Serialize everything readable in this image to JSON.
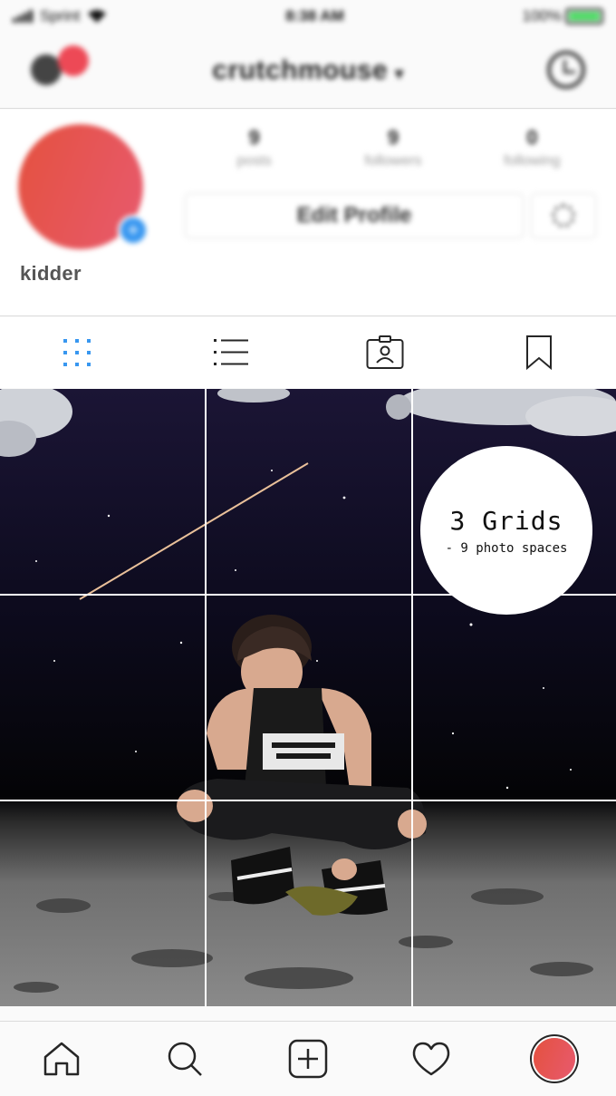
{
  "status_bar": {
    "carrier": "Sprint",
    "time": "8:38 AM",
    "battery": "100%"
  },
  "header": {
    "username": "crutchmouse",
    "dropdown_glyph": "▾"
  },
  "profile": {
    "avatar_add_glyph": "+",
    "display_name": "kidder",
    "stats": [
      {
        "number": "9",
        "label": "posts"
      },
      {
        "number": "9",
        "label": "followers"
      },
      {
        "number": "0",
        "label": "following"
      }
    ],
    "edit_button": "Edit Profile"
  },
  "tabs": [
    "grid-icon",
    "list-icon",
    "tagged-icon",
    "saved-icon"
  ],
  "grid": {
    "promo": {
      "title": "3 Grids",
      "subtitle": "- 9 photo spaces"
    }
  },
  "bottom_nav": [
    "home-icon",
    "search-icon",
    "new-post-icon",
    "activity-icon",
    "profile-icon"
  ],
  "colors": {
    "accent_blue": "#3897f0",
    "notification_red": "#ed4956",
    "avatar_red": "#e4513f"
  }
}
